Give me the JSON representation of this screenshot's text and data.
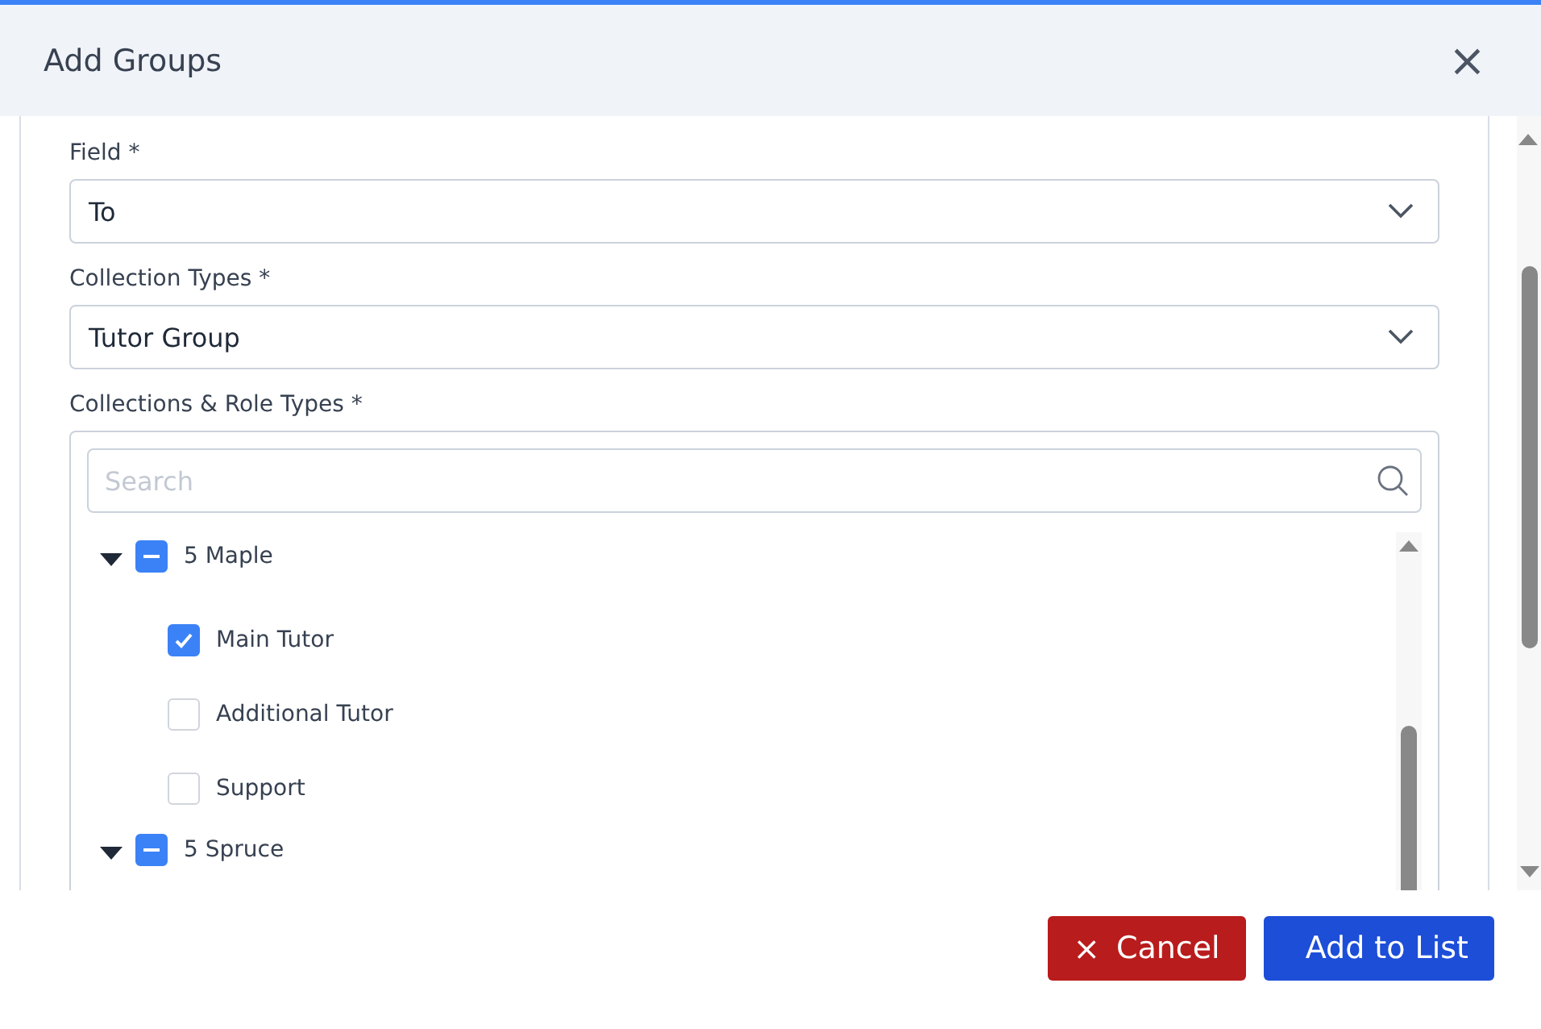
{
  "dialog": {
    "title": "Add Groups",
    "close": "×"
  },
  "fields": [
    {
      "label": "Field *",
      "value": "To"
    },
    {
      "label": "Collection Types *",
      "value": "Tutor Group"
    }
  ],
  "tree_field": {
    "label": "Collections & Role Types *",
    "search": {
      "placeholder": "Search"
    },
    "items": [
      {
        "label": "5 Maple",
        "expanded": true,
        "indeterminate": true,
        "children": [
          {
            "label": "Main Tutor",
            "checked": true
          },
          {
            "label": "Additional Tutor",
            "checked": false
          },
          {
            "label": "Support",
            "checked": false
          }
        ]
      },
      {
        "label": "5 Spruce",
        "expanded": true,
        "indeterminate": true
      }
    ]
  },
  "buttons": [
    {
      "kind": "cancel",
      "label": "Cancel",
      "icon": "×"
    },
    {
      "kind": "primary",
      "label": "Add to List"
    }
  ]
}
